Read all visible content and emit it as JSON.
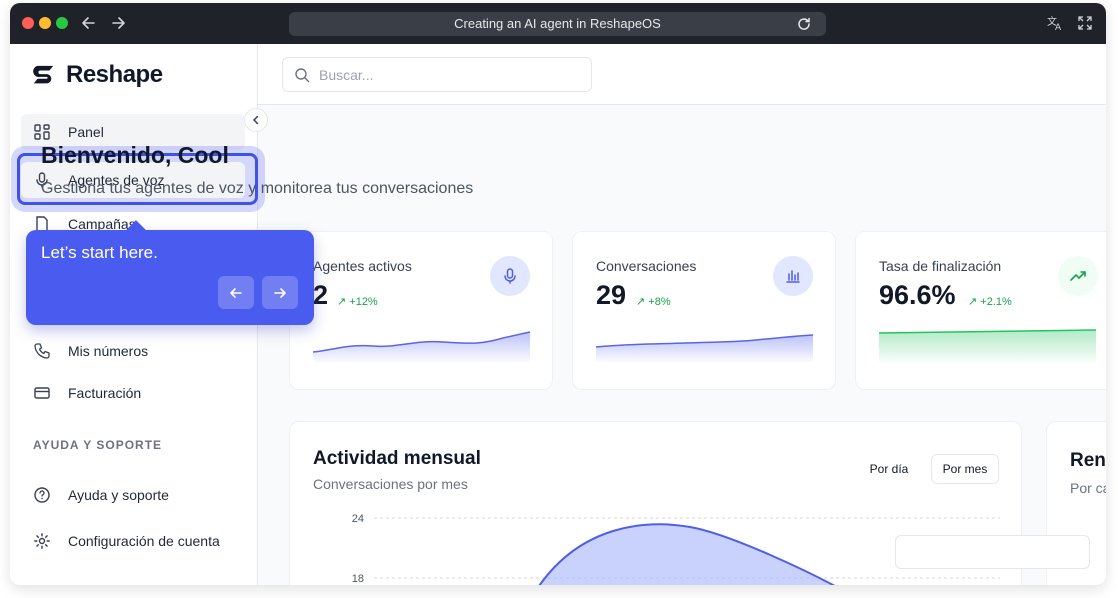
{
  "browser": {
    "address": "Creating an AI agent in ReshapeOS"
  },
  "app": {
    "brand": "Reshape"
  },
  "sidebar": {
    "items": [
      {
        "label": "Panel",
        "icon": "grid-icon"
      },
      {
        "label": "Agentes de voz",
        "icon": "microphone-icon"
      },
      {
        "label": "Campañas",
        "icon": "file-icon"
      },
      {
        "label": "Mis números",
        "icon": "phone-icon"
      },
      {
        "label": "Facturación",
        "icon": "credit-card-icon"
      }
    ],
    "section_support": "AYUDA Y SOPORTE",
    "support_items": [
      {
        "label": "Ayuda y soporte",
        "icon": "help-circle-icon"
      },
      {
        "label": "Configuración de cuenta",
        "icon": "gear-icon"
      }
    ]
  },
  "tour": {
    "text": "Let’s start here."
  },
  "search": {
    "placeholder": "Buscar...",
    "value": ""
  },
  "main": {
    "title": "Bienvenido, Cool",
    "subtitle": "Gestiona tus agentes de voz y monitorea tus conversaciones"
  },
  "stats": [
    {
      "label": "Agentes activos",
      "value": "2",
      "trend": "↗ +12%",
      "color": "#4f5ee6",
      "icon": "microphone-icon"
    },
    {
      "label": "Conversaciones",
      "value": "29",
      "trend": "↗ +8%",
      "color": "#4f5ee6",
      "icon": "bar-chart-icon"
    },
    {
      "label": "Tasa de finalización",
      "value": "96.6%",
      "trend": "↗ +2.1%",
      "color": "#16a34a",
      "icon": "trending-up-icon"
    }
  ],
  "activity": {
    "title": "Actividad mensual",
    "subtitle": "Conversaciones por mes",
    "btn_day": "Por día",
    "btn_month": "Por mes",
    "chart_data": {
      "type": "area",
      "y_ticks": [
        "24",
        "18"
      ],
      "ylim": [
        18,
        24
      ],
      "peak_value": 23
    }
  },
  "partial_card": {
    "title": "Ren",
    "subtitle": "Por ca"
  },
  "colors": {
    "accent": "#4153e6",
    "tooltip": "#4a5bf0",
    "positive": "#16a34a"
  }
}
